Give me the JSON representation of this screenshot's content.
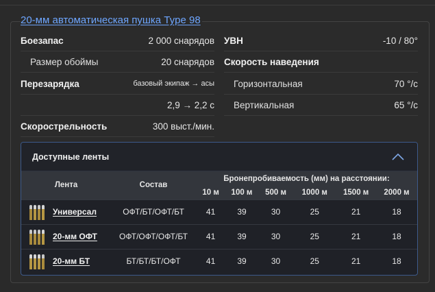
{
  "title": "20-мм автоматическая пушка Type 98",
  "left_stats": [
    {
      "label": "Боезапас",
      "value": "2 000 снарядов",
      "style": "bold"
    },
    {
      "label": "Размер обоймы",
      "value": "20 снарядов",
      "style": "sub"
    },
    {
      "label": "Перезарядка",
      "value": "базовый экипаж → асы",
      "style": "bold",
      "small": true
    },
    {
      "label": "",
      "value": "2,9 → 2,2 с",
      "style": "bold"
    },
    {
      "label": "Скорострельность",
      "value": "300 выст./мин.",
      "style": "bold"
    }
  ],
  "right_stats": [
    {
      "label": "УВН",
      "value": "-10 / 80°",
      "style": "bold"
    },
    {
      "label": "Скорость наведения",
      "value": "",
      "style": "bold"
    },
    {
      "label": "Горизонтальная",
      "value": "70 °/с",
      "style": "sub"
    },
    {
      "label": "Вертикальная",
      "value": "65 °/с",
      "style": "sub"
    }
  ],
  "belts": {
    "title": "Доступные ленты",
    "columns": {
      "belt": "Лента",
      "composition": "Состав",
      "penetration": "Бронепробиваемость (мм) на расстоянии:"
    },
    "distances": [
      "10 м",
      "100 м",
      "500 м",
      "1000 м",
      "1500 м",
      "2000 м"
    ],
    "rows": [
      {
        "name": "Универсал",
        "composition": "ОФТ/БТ/ОФТ/БТ",
        "values": [
          "41",
          "39",
          "30",
          "25",
          "21",
          "18"
        ]
      },
      {
        "name": "20-мм ОФТ",
        "composition": "ОФТ/ОФТ/ОФТ/БТ",
        "values": [
          "41",
          "39",
          "30",
          "25",
          "21",
          "18"
        ]
      },
      {
        "name": "20-мм БТ",
        "composition": "БТ/БТ/БТ/ОФТ",
        "values": [
          "41",
          "39",
          "30",
          "25",
          "21",
          "18"
        ]
      }
    ]
  },
  "icons": {
    "collapse": "chevron-up-icon",
    "ammo": "ammo-belt-icon"
  },
  "colors": {
    "link": "#6ea6ff",
    "accent_border": "#3d5a8c"
  }
}
